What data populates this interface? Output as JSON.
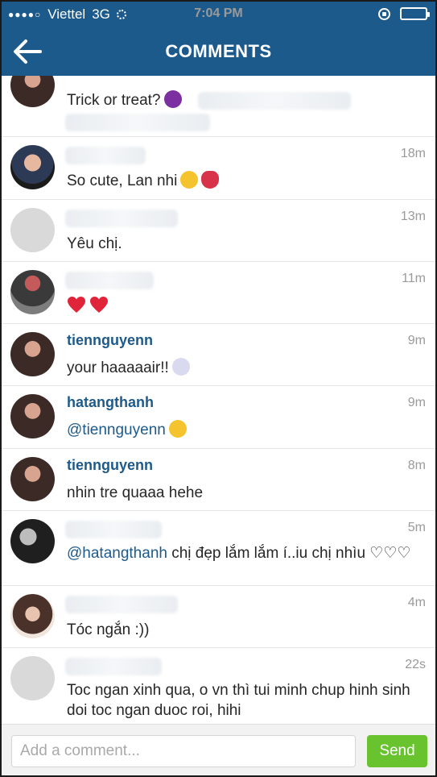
{
  "status_bar": {
    "signal_dots": "●●●●○",
    "carrier": "Viettel",
    "network": "3G",
    "time": "7:04 PM"
  },
  "header": {
    "title": "COMMENTS"
  },
  "comments": [
    {
      "username": "",
      "time": "",
      "text": "Trick or treat?"
    },
    {
      "username": "",
      "time": "18m",
      "text": "So cute, Lan nhi"
    },
    {
      "username": "",
      "time": "13m",
      "text": "Yêu chị."
    },
    {
      "username": "",
      "time": "11m",
      "text": ""
    },
    {
      "username": "tiennguyenn",
      "time": "9m",
      "text": "your haaaaair!!"
    },
    {
      "username": "hatangthanh",
      "time": "9m",
      "mention": "@tiennguyenn",
      "text": ""
    },
    {
      "username": "tiennguyenn",
      "time": "8m",
      "text": "nhin tre quaaa hehe"
    },
    {
      "username": "",
      "time": "5m",
      "mention": "@hatangthanh",
      "text": " chị đẹp lắm lắm í..iu chị nhìu ♡♡♡"
    },
    {
      "username": "",
      "time": "4m",
      "text": "Tóc ngắn :))"
    },
    {
      "username": "",
      "time": "22s",
      "text": "Toc ngan xinh qua, o vn thì tui minh chup hinh sinh doi toc ngan duoc roi, hihi"
    }
  ],
  "comment_input": {
    "placeholder": "Add a comment...",
    "send_label": "Send"
  },
  "colors": {
    "header": "#1d5a8c",
    "send_button": "#69c32e",
    "link": "#1d5a8c"
  }
}
